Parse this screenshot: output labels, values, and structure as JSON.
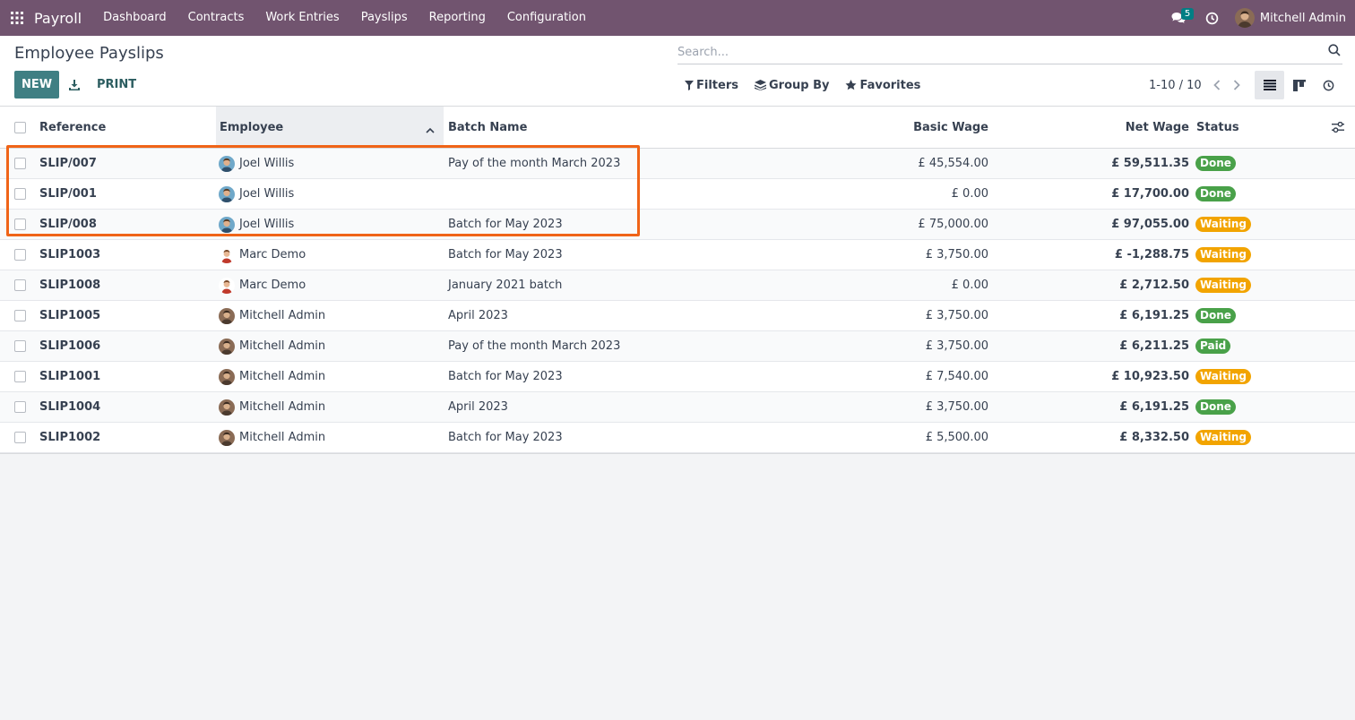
{
  "navbar": {
    "app_name": "Payroll",
    "menu": [
      "Dashboard",
      "Contracts",
      "Work Entries",
      "Payslips",
      "Reporting",
      "Configuration"
    ],
    "chat_count": "5",
    "user_name": "Mitchell Admin",
    "bg_color": "#71546f"
  },
  "control": {
    "title": "Employee Payslips",
    "new_label": "NEW",
    "print_label": "PRINT",
    "search_placeholder": "Search...",
    "filters_label": "Filters",
    "groupby_label": "Group By",
    "favorites_label": "Favorites",
    "pager": "1-10 / 10"
  },
  "table": {
    "columns": {
      "reference": "Reference",
      "employee": "Employee",
      "batch": "Batch Name",
      "basic": "Basic Wage",
      "net": "Net Wage",
      "status": "Status"
    },
    "rows": [
      {
        "ref": "SLIP/007",
        "employee": "Joel Willis",
        "avatar": "joel",
        "batch": "Pay of the month March 2023",
        "basic": "£ 45,554.00",
        "net": "£ 59,511.35",
        "status": "Done",
        "status_kind": "done"
      },
      {
        "ref": "SLIP/001",
        "employee": "Joel Willis",
        "avatar": "joel",
        "batch": "",
        "basic": "£ 0.00",
        "net": "£ 17,700.00",
        "status": "Done",
        "status_kind": "done"
      },
      {
        "ref": "SLIP/008",
        "employee": "Joel Willis",
        "avatar": "joel",
        "batch": "Batch for May 2023",
        "basic": "£ 75,000.00",
        "net": "£ 97,055.00",
        "status": "Waiting",
        "status_kind": "waiting"
      },
      {
        "ref": "SLIP1003",
        "employee": "Marc Demo",
        "avatar": "marc",
        "batch": "Batch for May 2023",
        "basic": "£ 3,750.00",
        "net": "£ -1,288.75",
        "status": "Waiting",
        "status_kind": "waiting"
      },
      {
        "ref": "SLIP1008",
        "employee": "Marc Demo",
        "avatar": "marc",
        "batch": "January 2021 batch",
        "basic": "£ 0.00",
        "net": "£ 2,712.50",
        "status": "Waiting",
        "status_kind": "waiting"
      },
      {
        "ref": "SLIP1005",
        "employee": "Mitchell Admin",
        "avatar": "mitchell",
        "batch": "April 2023",
        "basic": "£ 3,750.00",
        "net": "£ 6,191.25",
        "status": "Done",
        "status_kind": "done"
      },
      {
        "ref": "SLIP1006",
        "employee": "Mitchell Admin",
        "avatar": "mitchell",
        "batch": "Pay of the month March 2023",
        "basic": "£ 3,750.00",
        "net": "£ 6,211.25",
        "status": "Paid",
        "status_kind": "paid"
      },
      {
        "ref": "SLIP1001",
        "employee": "Mitchell Admin",
        "avatar": "mitchell",
        "batch": "Batch for May 2023",
        "basic": "£ 7,540.00",
        "net": "£ 10,923.50",
        "status": "Waiting",
        "status_kind": "waiting"
      },
      {
        "ref": "SLIP1004",
        "employee": "Mitchell Admin",
        "avatar": "mitchell",
        "batch": "April 2023",
        "basic": "£ 3,750.00",
        "net": "£ 6,191.25",
        "status": "Done",
        "status_kind": "done"
      },
      {
        "ref": "SLIP1002",
        "employee": "Mitchell Admin",
        "avatar": "mitchell",
        "batch": "Batch for May 2023",
        "basic": "£ 5,500.00",
        "net": "£ 8,332.50",
        "status": "Waiting",
        "status_kind": "waiting"
      }
    ]
  },
  "highlight_color": "#f06418"
}
